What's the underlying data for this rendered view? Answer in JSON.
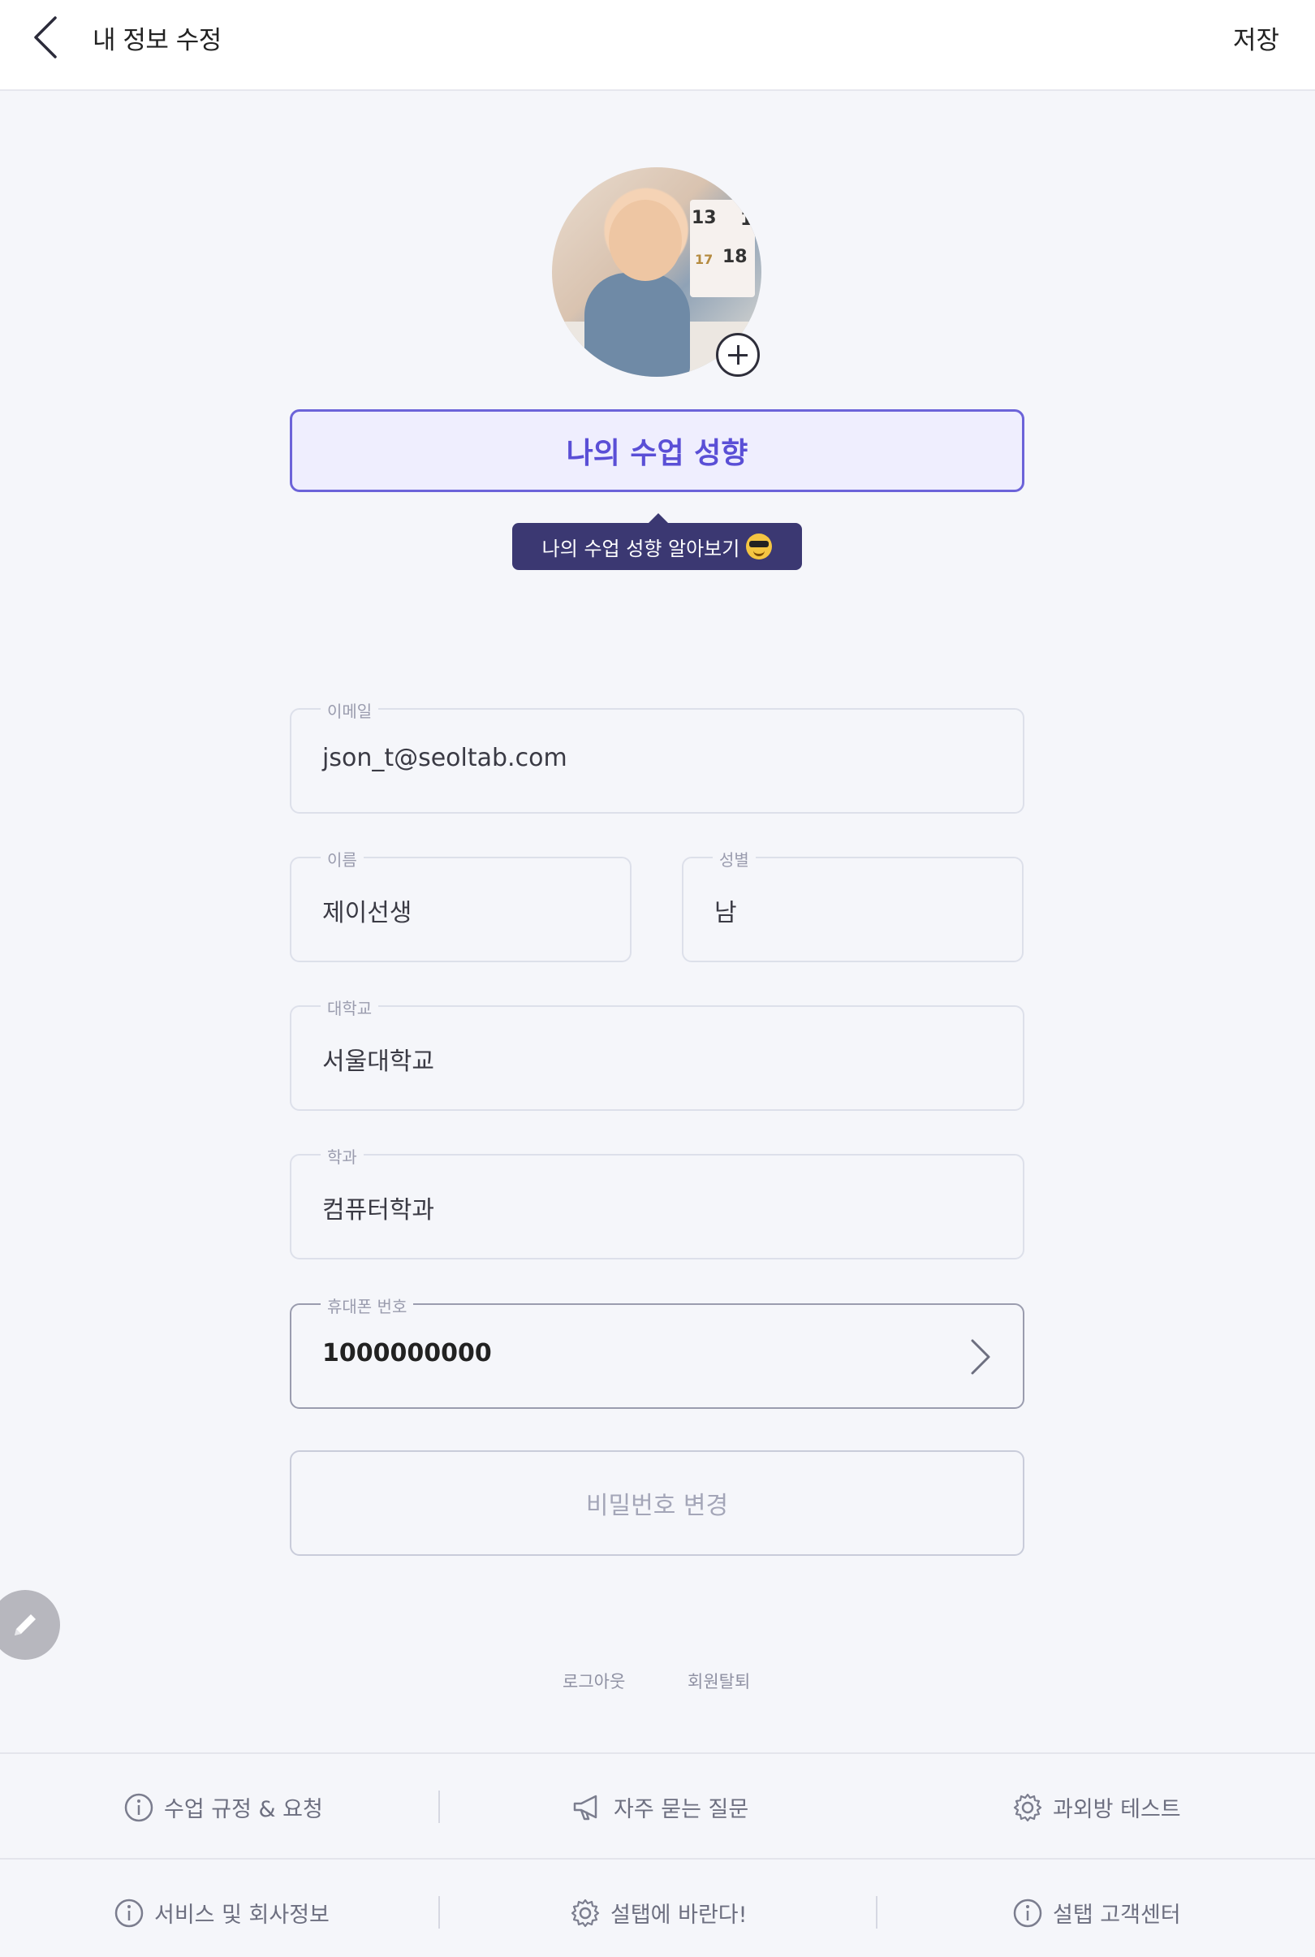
{
  "header": {
    "title": "내 정보 수정",
    "save_label": "저장"
  },
  "profile": {
    "photo_alt": "profile photo",
    "add_photo_icon": "plus-circle-icon"
  },
  "teaching_style": {
    "button_label": "나의 수업 성향",
    "tooltip": "나의 수업 성향 알아보기"
  },
  "form": {
    "email": {
      "label": "이메일",
      "value": "json_t@seoltab.com"
    },
    "name": {
      "label": "이름",
      "value": "제이선생"
    },
    "gender": {
      "label": "성별",
      "value": "남"
    },
    "university": {
      "label": "대학교",
      "value": "서울대학교"
    },
    "major": {
      "label": "학과",
      "value": "컴퓨터학과"
    },
    "phone": {
      "label": "휴대폰 번호",
      "value": "1000000000"
    },
    "password_button": "비밀번호 변경"
  },
  "account_links": {
    "logout": "로그아웃",
    "withdraw": "회원탈퇴"
  },
  "footer": {
    "row1": [
      {
        "label": "수업 규정 & 요청",
        "icon": "info-icon"
      },
      {
        "label": "자주 묻는 질문",
        "icon": "megaphone-icon"
      },
      {
        "label": "과외방 테스트",
        "icon": "gear-icon"
      }
    ],
    "row2": [
      {
        "label": "서비스 및 회사정보",
        "icon": "info-icon"
      },
      {
        "label": "설탭에 바란다!",
        "icon": "gear-icon"
      },
      {
        "label": "설탭 고객센터",
        "icon": "info-icon"
      }
    ]
  },
  "colors": {
    "accent": "#5a4fd6",
    "tooltip_bg": "#3b3872",
    "background": "#f5f6fa"
  }
}
